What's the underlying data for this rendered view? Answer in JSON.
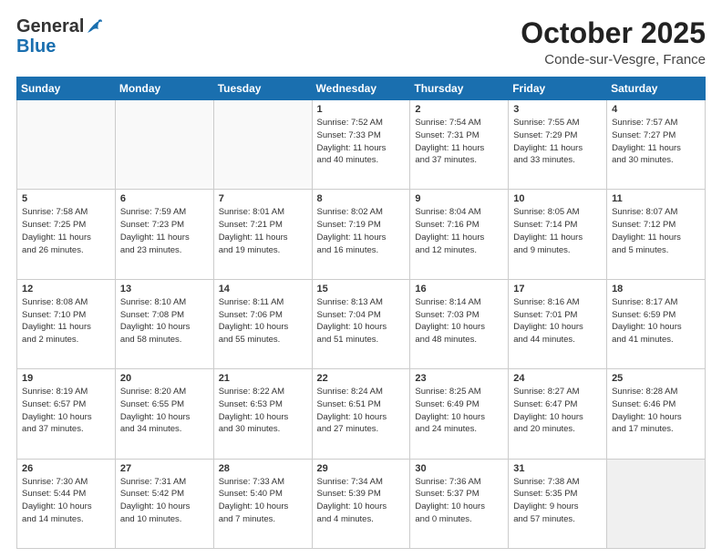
{
  "header": {
    "logo_general": "General",
    "logo_blue": "Blue",
    "month": "October 2025",
    "location": "Conde-sur-Vesgre, France"
  },
  "weekdays": [
    "Sunday",
    "Monday",
    "Tuesday",
    "Wednesday",
    "Thursday",
    "Friday",
    "Saturday"
  ],
  "weeks": [
    [
      {
        "day": "",
        "info": ""
      },
      {
        "day": "",
        "info": ""
      },
      {
        "day": "",
        "info": ""
      },
      {
        "day": "1",
        "info": "Sunrise: 7:52 AM\nSunset: 7:33 PM\nDaylight: 11 hours\nand 40 minutes."
      },
      {
        "day": "2",
        "info": "Sunrise: 7:54 AM\nSunset: 7:31 PM\nDaylight: 11 hours\nand 37 minutes."
      },
      {
        "day": "3",
        "info": "Sunrise: 7:55 AM\nSunset: 7:29 PM\nDaylight: 11 hours\nand 33 minutes."
      },
      {
        "day": "4",
        "info": "Sunrise: 7:57 AM\nSunset: 7:27 PM\nDaylight: 11 hours\nand 30 minutes."
      }
    ],
    [
      {
        "day": "5",
        "info": "Sunrise: 7:58 AM\nSunset: 7:25 PM\nDaylight: 11 hours\nand 26 minutes."
      },
      {
        "day": "6",
        "info": "Sunrise: 7:59 AM\nSunset: 7:23 PM\nDaylight: 11 hours\nand 23 minutes."
      },
      {
        "day": "7",
        "info": "Sunrise: 8:01 AM\nSunset: 7:21 PM\nDaylight: 11 hours\nand 19 minutes."
      },
      {
        "day": "8",
        "info": "Sunrise: 8:02 AM\nSunset: 7:19 PM\nDaylight: 11 hours\nand 16 minutes."
      },
      {
        "day": "9",
        "info": "Sunrise: 8:04 AM\nSunset: 7:16 PM\nDaylight: 11 hours\nand 12 minutes."
      },
      {
        "day": "10",
        "info": "Sunrise: 8:05 AM\nSunset: 7:14 PM\nDaylight: 11 hours\nand 9 minutes."
      },
      {
        "day": "11",
        "info": "Sunrise: 8:07 AM\nSunset: 7:12 PM\nDaylight: 11 hours\nand 5 minutes."
      }
    ],
    [
      {
        "day": "12",
        "info": "Sunrise: 8:08 AM\nSunset: 7:10 PM\nDaylight: 11 hours\nand 2 minutes."
      },
      {
        "day": "13",
        "info": "Sunrise: 8:10 AM\nSunset: 7:08 PM\nDaylight: 10 hours\nand 58 minutes."
      },
      {
        "day": "14",
        "info": "Sunrise: 8:11 AM\nSunset: 7:06 PM\nDaylight: 10 hours\nand 55 minutes."
      },
      {
        "day": "15",
        "info": "Sunrise: 8:13 AM\nSunset: 7:04 PM\nDaylight: 10 hours\nand 51 minutes."
      },
      {
        "day": "16",
        "info": "Sunrise: 8:14 AM\nSunset: 7:03 PM\nDaylight: 10 hours\nand 48 minutes."
      },
      {
        "day": "17",
        "info": "Sunrise: 8:16 AM\nSunset: 7:01 PM\nDaylight: 10 hours\nand 44 minutes."
      },
      {
        "day": "18",
        "info": "Sunrise: 8:17 AM\nSunset: 6:59 PM\nDaylight: 10 hours\nand 41 minutes."
      }
    ],
    [
      {
        "day": "19",
        "info": "Sunrise: 8:19 AM\nSunset: 6:57 PM\nDaylight: 10 hours\nand 37 minutes."
      },
      {
        "day": "20",
        "info": "Sunrise: 8:20 AM\nSunset: 6:55 PM\nDaylight: 10 hours\nand 34 minutes."
      },
      {
        "day": "21",
        "info": "Sunrise: 8:22 AM\nSunset: 6:53 PM\nDaylight: 10 hours\nand 30 minutes."
      },
      {
        "day": "22",
        "info": "Sunrise: 8:24 AM\nSunset: 6:51 PM\nDaylight: 10 hours\nand 27 minutes."
      },
      {
        "day": "23",
        "info": "Sunrise: 8:25 AM\nSunset: 6:49 PM\nDaylight: 10 hours\nand 24 minutes."
      },
      {
        "day": "24",
        "info": "Sunrise: 8:27 AM\nSunset: 6:47 PM\nDaylight: 10 hours\nand 20 minutes."
      },
      {
        "day": "25",
        "info": "Sunrise: 8:28 AM\nSunset: 6:46 PM\nDaylight: 10 hours\nand 17 minutes."
      }
    ],
    [
      {
        "day": "26",
        "info": "Sunrise: 7:30 AM\nSunset: 5:44 PM\nDaylight: 10 hours\nand 14 minutes."
      },
      {
        "day": "27",
        "info": "Sunrise: 7:31 AM\nSunset: 5:42 PM\nDaylight: 10 hours\nand 10 minutes."
      },
      {
        "day": "28",
        "info": "Sunrise: 7:33 AM\nSunset: 5:40 PM\nDaylight: 10 hours\nand 7 minutes."
      },
      {
        "day": "29",
        "info": "Sunrise: 7:34 AM\nSunset: 5:39 PM\nDaylight: 10 hours\nand 4 minutes."
      },
      {
        "day": "30",
        "info": "Sunrise: 7:36 AM\nSunset: 5:37 PM\nDaylight: 10 hours\nand 0 minutes."
      },
      {
        "day": "31",
        "info": "Sunrise: 7:38 AM\nSunset: 5:35 PM\nDaylight: 9 hours\nand 57 minutes."
      },
      {
        "day": "",
        "info": ""
      }
    ]
  ]
}
